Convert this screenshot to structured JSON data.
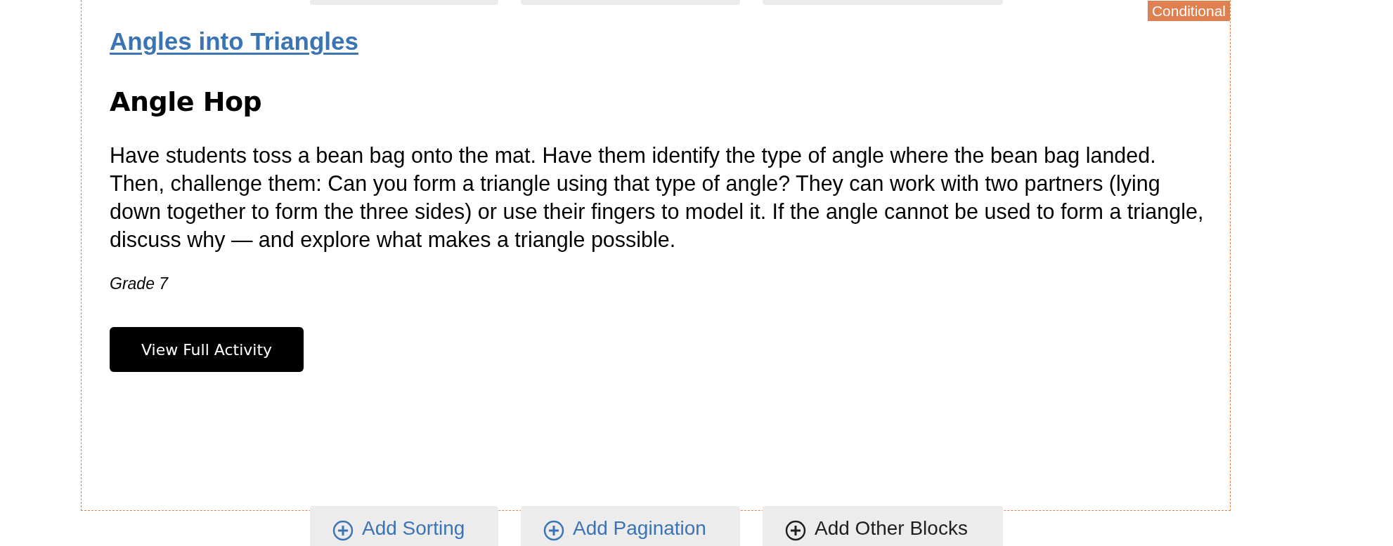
{
  "badge": "Conditional",
  "activity": {
    "category": "Angles into Triangles",
    "title": "Angle Hop",
    "description": "Have students toss a bean bag onto the mat. Have them identify the type of angle where the bean bag landed. Then, challenge them: Can you form a triangle using that type of angle? They can work with two partners (lying down together to form the three sides) or use their fingers to model it. If the angle cannot be used to form a triangle, discuss why — and explore what makes a triangle possible.",
    "grade": "Grade 7",
    "button": "View Full Activity"
  },
  "toolbar": [
    {
      "label": "Add Sorting",
      "color": "#3a74b4"
    },
    {
      "label": "Add Pagination",
      "color": "#3a74b4"
    },
    {
      "label": "Add Other Blocks",
      "color": "#1e1e1e"
    }
  ]
}
